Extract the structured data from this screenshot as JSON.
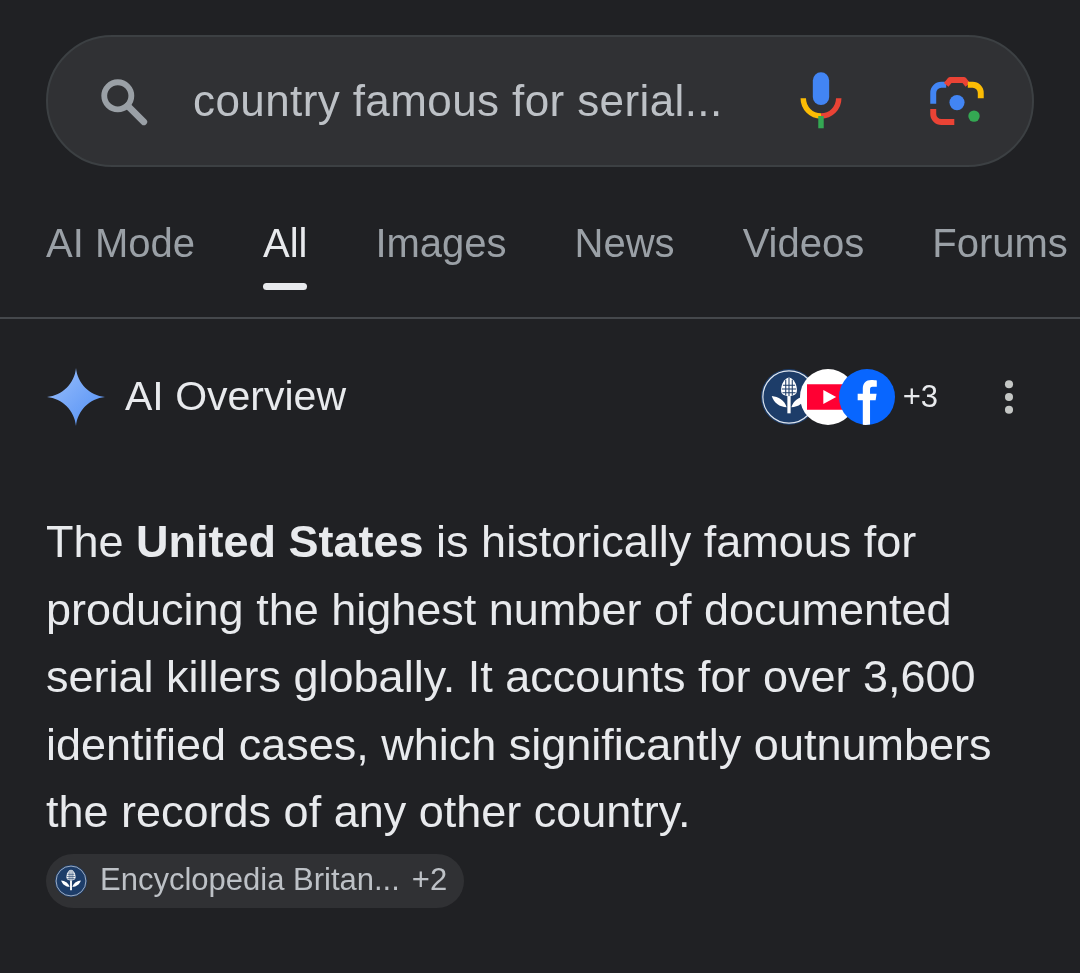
{
  "search": {
    "value": "country famous for serial..."
  },
  "tabs": [
    {
      "label": "AI Mode",
      "selected": false
    },
    {
      "label": "All",
      "selected": true
    },
    {
      "label": "Images",
      "selected": false
    },
    {
      "label": "News",
      "selected": false
    },
    {
      "label": "Videos",
      "selected": false
    },
    {
      "label": "Forums",
      "selected": false
    }
  ],
  "ai_overview": {
    "title": "AI Overview",
    "sources_more": "+3",
    "summary": "The **United States** is historically famous for producing the highest number of documented serial killers globally. It accounts for over 3,600 identified cases, which significantly outnumbers the records of any other country.",
    "source_chip": {
      "label": "Encyclopedia Britan...",
      "more": "+2"
    }
  }
}
